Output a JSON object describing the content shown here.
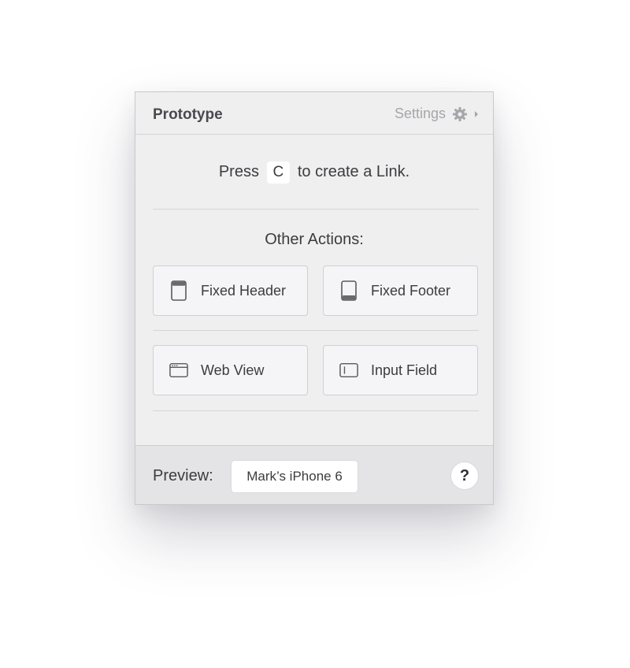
{
  "header": {
    "title": "Prototype",
    "settings_label": "Settings",
    "settings_icon": "gear-icon",
    "caret_icon": "caret-right-icon"
  },
  "shortcut": {
    "prefix": "Press",
    "key": "C",
    "suffix": "to create a Link."
  },
  "actions": {
    "heading": "Other Actions:",
    "items": [
      {
        "label": "Fixed Header",
        "icon": "fixed-header-icon"
      },
      {
        "label": "Fixed Footer",
        "icon": "fixed-footer-icon"
      },
      {
        "label": "Web View",
        "icon": "web-view-icon"
      },
      {
        "label": "Input Field",
        "icon": "input-field-icon"
      }
    ]
  },
  "footer": {
    "preview_label": "Preview:",
    "device": "Mark’s iPhone 6",
    "help_label": "?"
  },
  "colors": {
    "panel_bg": "#efeff0",
    "footer_bg": "#e4e4e6",
    "button_bg": "#f5f5f7",
    "text": "#3c3c40",
    "muted": "#a6a6aa"
  }
}
